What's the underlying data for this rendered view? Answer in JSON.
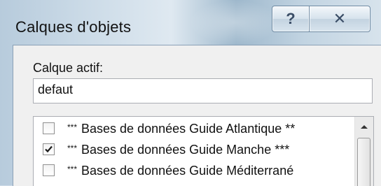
{
  "window": {
    "title": "Calques d'objets",
    "help_button": "?",
    "close_button": "✕"
  },
  "active_layer": {
    "label": "Calque actif:",
    "value": "defaut"
  },
  "layers": [
    {
      "stars": "***",
      "label": "Bases de données Guide Atlantique **",
      "checked": false
    },
    {
      "stars": "***",
      "label": "Bases de données Guide Manche ***",
      "checked": true
    },
    {
      "stars": "***",
      "label": "Bases de données Guide Méditerrané",
      "checked": false
    }
  ],
  "scrollbar": {
    "up_icon": "scroll-up-arrow-icon"
  }
}
